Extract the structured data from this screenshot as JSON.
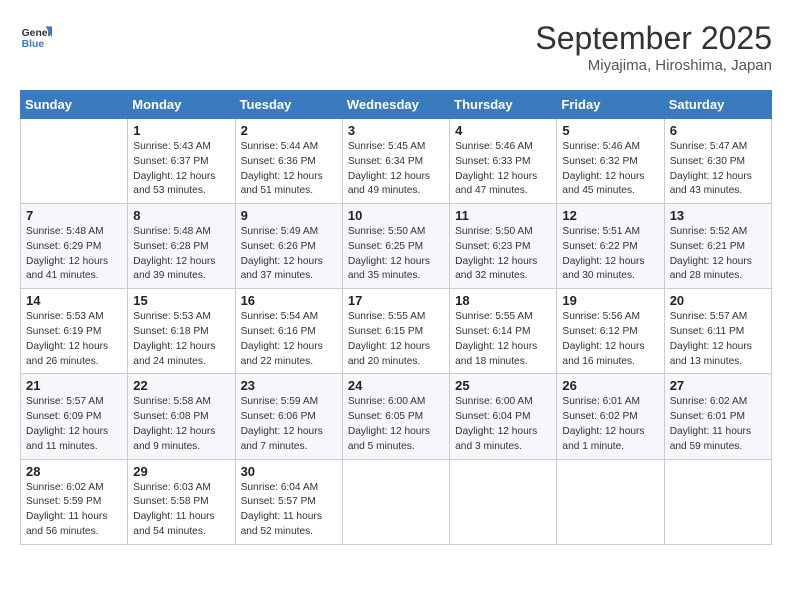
{
  "header": {
    "logo_line1": "General",
    "logo_line2": "Blue",
    "month": "September 2025",
    "location": "Miyajima, Hiroshima, Japan"
  },
  "weekdays": [
    "Sunday",
    "Monday",
    "Tuesday",
    "Wednesday",
    "Thursday",
    "Friday",
    "Saturday"
  ],
  "weeks": [
    [
      {
        "day": "",
        "info": ""
      },
      {
        "day": "1",
        "info": "Sunrise: 5:43 AM\nSunset: 6:37 PM\nDaylight: 12 hours\nand 53 minutes."
      },
      {
        "day": "2",
        "info": "Sunrise: 5:44 AM\nSunset: 6:36 PM\nDaylight: 12 hours\nand 51 minutes."
      },
      {
        "day": "3",
        "info": "Sunrise: 5:45 AM\nSunset: 6:34 PM\nDaylight: 12 hours\nand 49 minutes."
      },
      {
        "day": "4",
        "info": "Sunrise: 5:46 AM\nSunset: 6:33 PM\nDaylight: 12 hours\nand 47 minutes."
      },
      {
        "day": "5",
        "info": "Sunrise: 5:46 AM\nSunset: 6:32 PM\nDaylight: 12 hours\nand 45 minutes."
      },
      {
        "day": "6",
        "info": "Sunrise: 5:47 AM\nSunset: 6:30 PM\nDaylight: 12 hours\nand 43 minutes."
      }
    ],
    [
      {
        "day": "7",
        "info": "Sunrise: 5:48 AM\nSunset: 6:29 PM\nDaylight: 12 hours\nand 41 minutes."
      },
      {
        "day": "8",
        "info": "Sunrise: 5:48 AM\nSunset: 6:28 PM\nDaylight: 12 hours\nand 39 minutes."
      },
      {
        "day": "9",
        "info": "Sunrise: 5:49 AM\nSunset: 6:26 PM\nDaylight: 12 hours\nand 37 minutes."
      },
      {
        "day": "10",
        "info": "Sunrise: 5:50 AM\nSunset: 6:25 PM\nDaylight: 12 hours\nand 35 minutes."
      },
      {
        "day": "11",
        "info": "Sunrise: 5:50 AM\nSunset: 6:23 PM\nDaylight: 12 hours\nand 32 minutes."
      },
      {
        "day": "12",
        "info": "Sunrise: 5:51 AM\nSunset: 6:22 PM\nDaylight: 12 hours\nand 30 minutes."
      },
      {
        "day": "13",
        "info": "Sunrise: 5:52 AM\nSunset: 6:21 PM\nDaylight: 12 hours\nand 28 minutes."
      }
    ],
    [
      {
        "day": "14",
        "info": "Sunrise: 5:53 AM\nSunset: 6:19 PM\nDaylight: 12 hours\nand 26 minutes."
      },
      {
        "day": "15",
        "info": "Sunrise: 5:53 AM\nSunset: 6:18 PM\nDaylight: 12 hours\nand 24 minutes."
      },
      {
        "day": "16",
        "info": "Sunrise: 5:54 AM\nSunset: 6:16 PM\nDaylight: 12 hours\nand 22 minutes."
      },
      {
        "day": "17",
        "info": "Sunrise: 5:55 AM\nSunset: 6:15 PM\nDaylight: 12 hours\nand 20 minutes."
      },
      {
        "day": "18",
        "info": "Sunrise: 5:55 AM\nSunset: 6:14 PM\nDaylight: 12 hours\nand 18 minutes."
      },
      {
        "day": "19",
        "info": "Sunrise: 5:56 AM\nSunset: 6:12 PM\nDaylight: 12 hours\nand 16 minutes."
      },
      {
        "day": "20",
        "info": "Sunrise: 5:57 AM\nSunset: 6:11 PM\nDaylight: 12 hours\nand 13 minutes."
      }
    ],
    [
      {
        "day": "21",
        "info": "Sunrise: 5:57 AM\nSunset: 6:09 PM\nDaylight: 12 hours\nand 11 minutes."
      },
      {
        "day": "22",
        "info": "Sunrise: 5:58 AM\nSunset: 6:08 PM\nDaylight: 12 hours\nand 9 minutes."
      },
      {
        "day": "23",
        "info": "Sunrise: 5:59 AM\nSunset: 6:06 PM\nDaylight: 12 hours\nand 7 minutes."
      },
      {
        "day": "24",
        "info": "Sunrise: 6:00 AM\nSunset: 6:05 PM\nDaylight: 12 hours\nand 5 minutes."
      },
      {
        "day": "25",
        "info": "Sunrise: 6:00 AM\nSunset: 6:04 PM\nDaylight: 12 hours\nand 3 minutes."
      },
      {
        "day": "26",
        "info": "Sunrise: 6:01 AM\nSunset: 6:02 PM\nDaylight: 12 hours\nand 1 minute."
      },
      {
        "day": "27",
        "info": "Sunrise: 6:02 AM\nSunset: 6:01 PM\nDaylight: 11 hours\nand 59 minutes."
      }
    ],
    [
      {
        "day": "28",
        "info": "Sunrise: 6:02 AM\nSunset: 5:59 PM\nDaylight: 11 hours\nand 56 minutes."
      },
      {
        "day": "29",
        "info": "Sunrise: 6:03 AM\nSunset: 5:58 PM\nDaylight: 11 hours\nand 54 minutes."
      },
      {
        "day": "30",
        "info": "Sunrise: 6:04 AM\nSunset: 5:57 PM\nDaylight: 11 hours\nand 52 minutes."
      },
      {
        "day": "",
        "info": ""
      },
      {
        "day": "",
        "info": ""
      },
      {
        "day": "",
        "info": ""
      },
      {
        "day": "",
        "info": ""
      }
    ]
  ]
}
